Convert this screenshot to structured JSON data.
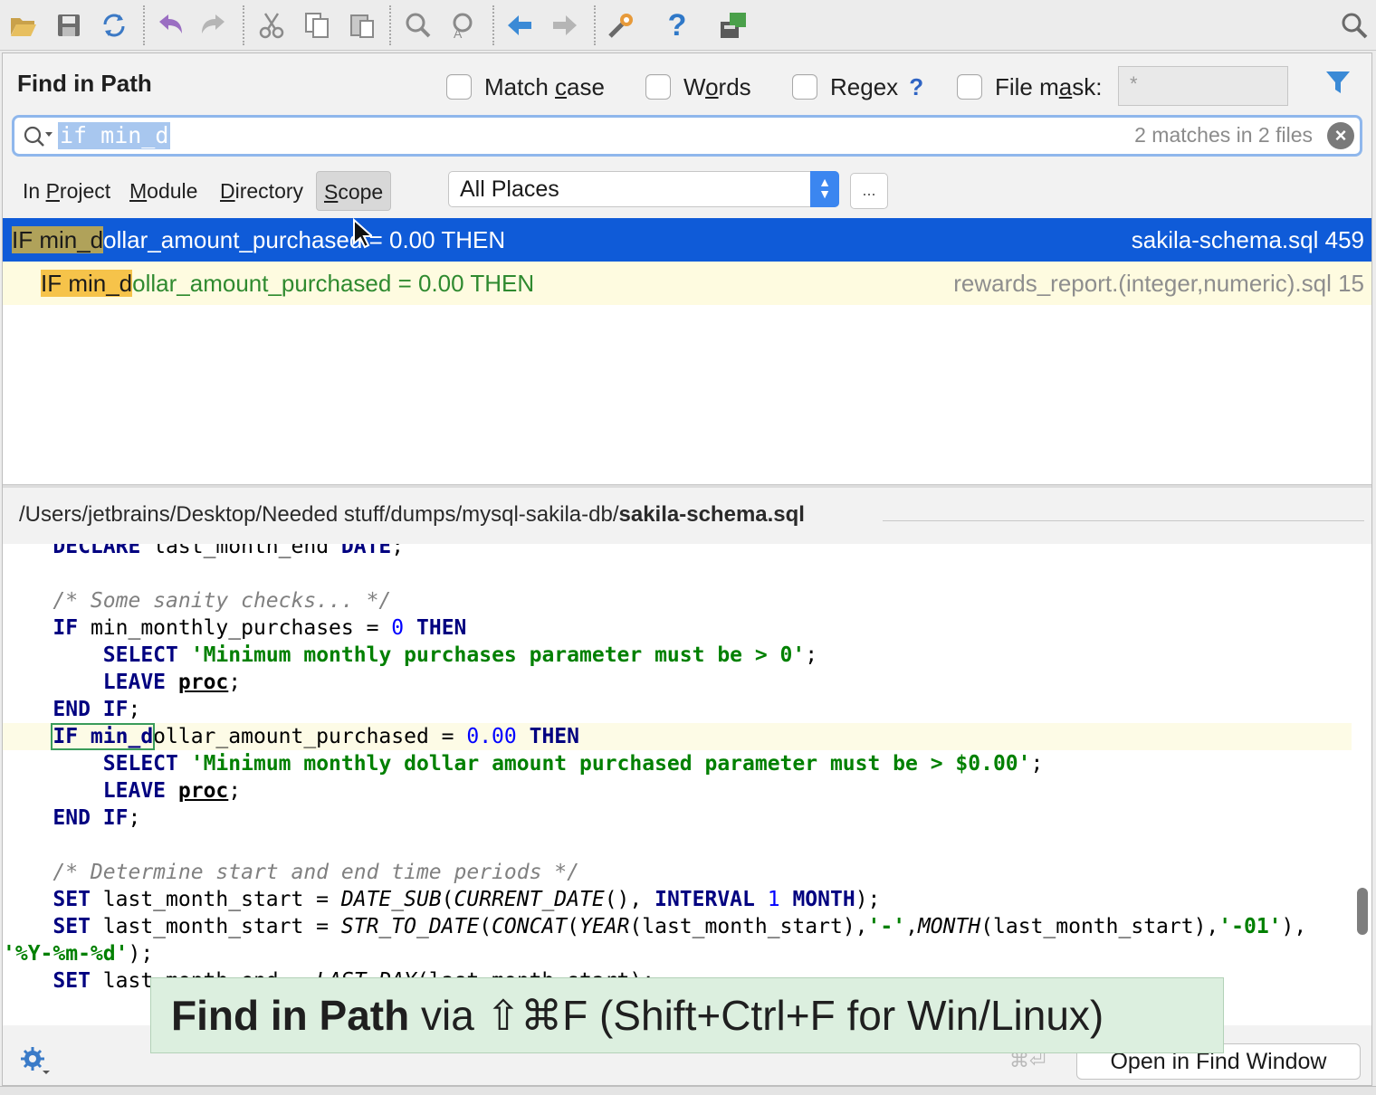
{
  "toolbar": {
    "icons": [
      "open-folder-icon",
      "save-icon",
      "sync-icon",
      "undo-icon",
      "redo-icon",
      "cut-icon",
      "copy-icon",
      "paste-icon",
      "find-icon",
      "replace-icon",
      "back-icon",
      "forward-icon",
      "settings-tools-icon",
      "help-icon",
      "database-console-icon",
      "search-everywhere-icon"
    ]
  },
  "dialog": {
    "title": "Find in Path",
    "options": {
      "match_case": {
        "pre": "Match ",
        "u": "c",
        "post": "ase",
        "checked": false
      },
      "words": {
        "pre": "W",
        "u": "o",
        "post": "rds",
        "checked": false
      },
      "regex": {
        "pre": "Re",
        "u": "g",
        "post": "ex",
        "checked": false,
        "help": "?"
      },
      "file_mask": {
        "pre": "File m",
        "u": "a",
        "post": "sk:",
        "checked": false,
        "value": "*"
      }
    },
    "search": {
      "query": "if min_d",
      "match_count": "2 matches in 2 files"
    },
    "scopes": [
      {
        "u": "P",
        "pre": "In ",
        "post": "roject"
      },
      {
        "u": "M",
        "pre": "",
        "post": "odule"
      },
      {
        "u": "D",
        "pre": "",
        "post": "irectory"
      },
      {
        "u": "S",
        "pre": "",
        "post": "cope"
      }
    ],
    "scope_select": "All Places",
    "more_button": "..."
  },
  "results": [
    {
      "match": "IF min_d",
      "rest": "ollar_amount_purchased = 0.00 THEN",
      "file": "sakila-schema.sql 459",
      "selected": true
    },
    {
      "match": "IF min_d",
      "rest": "ollar_amount_purchased = 0.00 THEN",
      "file": "rewards_report.(integer,numeric).sql 15",
      "selected": false
    }
  ],
  "preview": {
    "path_prefix": "/Users/jetbrains/Desktop/Needed stuff/dumps/mysql-sakila-db/",
    "path_file": "sakila-schema.sql"
  },
  "code": {
    "l0": {
      "kw1": "DECLARE",
      "t1": " last_month_end ",
      "kw2": "DATE",
      "t2": ";"
    },
    "l2": "/* Some sanity checks... */",
    "l3": {
      "kw1": "IF",
      "t1": " min_monthly_purchases = ",
      "n1": "0",
      "sp": " ",
      "kw2": "THEN"
    },
    "l4": {
      "kw1": "SELECT",
      "sp": " ",
      "s1": "'Minimum monthly purchases parameter must be > 0'",
      "t1": ";"
    },
    "l5": {
      "kw1": "LEAVE",
      "sp": " ",
      "u1": "proc",
      "t1": ";"
    },
    "l6": {
      "kw1": "END IF",
      "t1": ";"
    },
    "l7": {
      "m1": "IF min_d",
      "t1": "ollar_amount_purchased = ",
      "n1": "0.00",
      "sp": " ",
      "kw2": "THEN"
    },
    "l8": {
      "kw1": "SELECT",
      "sp": " ",
      "s1": "'Minimum monthly dollar amount purchased parameter must be > $0.00'",
      "t1": ";"
    },
    "l9": {
      "kw1": "LEAVE",
      "sp": " ",
      "u1": "proc",
      "t1": ";"
    },
    "l10": {
      "kw1": "END IF",
      "t1": ";"
    },
    "l12": "/* Determine start and end time periods */",
    "l13": {
      "kw1": "SET",
      "t1": " last_month_start = ",
      "f1": "DATE_SUB",
      "t2": "(",
      "f2": "CURRENT_DATE",
      "t3": "(), ",
      "kw2": "INTERVAL",
      "sp": " ",
      "n1": "1",
      "sp2": " ",
      "kw3": "MONTH",
      "t4": ");"
    },
    "l14": {
      "kw1": "SET",
      "t1": " last_month_start = ",
      "f1": "STR_TO_DATE",
      "t2": "(",
      "f2": "CONCAT",
      "t3": "(",
      "f3": "YEAR",
      "t4": "(last_month_start),",
      "s1": "'-'",
      "t5": ",",
      "f4": "MONTH",
      "t6": "(last_month_start),",
      "s2": "'-01'",
      "t7": "),"
    },
    "l15": {
      "s1": "'%Y-%m-%d'",
      "t1": ");"
    },
    "l16": {
      "kw1": "SET",
      "t1": " last_month_end = ",
      "f1": "LAST_DAY",
      "t2": "(last_month_start);"
    }
  },
  "footer": {
    "shortcut_hint": "⌘⏎",
    "open_button": "Open in Find Window"
  },
  "banner": {
    "bold": "Find in Path",
    "rest": " via ⇧⌘F (Shift+Ctrl+F for Win/Linux)"
  }
}
